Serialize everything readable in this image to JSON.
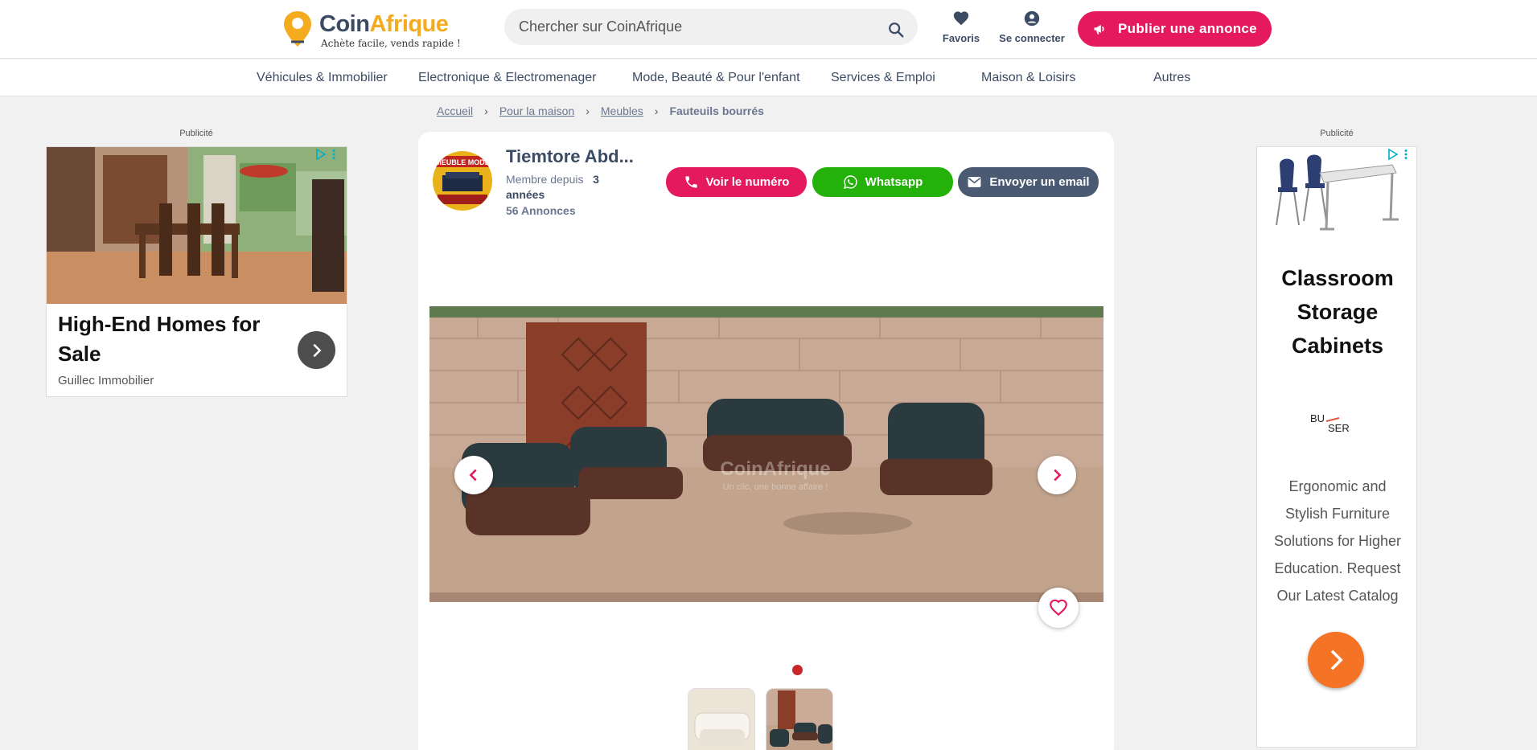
{
  "header": {
    "logo": {
      "part1": "Coin",
      "part2": "Afrique",
      "tagline": "Achète facile, vends rapide !"
    },
    "search": {
      "placeholder": "Chercher sur CoinAfrique",
      "icon": "search-icon"
    },
    "favorites_label": "Favoris",
    "login_label": "Se connecter",
    "publish_label": "Publier une annonce"
  },
  "nav": {
    "items": [
      "Véhicules & Immobilier",
      "Electronique & Electromenager",
      "Mode, Beauté & Pour l'enfant",
      "Services & Emploi",
      "Maison & Loisirs",
      "Autres"
    ]
  },
  "breadcrumb": [
    "Accueil",
    "Pour la maison",
    "Meubles",
    "Fauteuils bourrés"
  ],
  "ads": {
    "label": "Publicité",
    "left": {
      "title": "High-End Homes for Sale",
      "brand": "Guillec Immobilier"
    },
    "right": {
      "title": "Classroom Storage Cabinets",
      "logo_text": "BUSER",
      "description": "Ergonomic and Stylish Furniture Solutions for Higher Education. Request Our Latest Catalog"
    }
  },
  "seller": {
    "name": "Tiemtore Abd...",
    "member_prefix": "Membre depuis",
    "member_duration": "3 années",
    "listings": "56 Annonces",
    "avatar_text": "MEUBLE MODE"
  },
  "actions": {
    "phone": "Voir le numéro",
    "whatsapp": "Whatsapp",
    "email": "Envoyer un email"
  },
  "photo": {
    "watermark": "CoinAfrique",
    "watermark_sub": "Un clic, une bonne affaire !"
  },
  "colors": {
    "primary": "#e5195e",
    "whatsapp": "#23b10a",
    "email": "#4b5a73",
    "brand_dark": "#3c4b64",
    "brand_gold": "#f4ab1d"
  }
}
